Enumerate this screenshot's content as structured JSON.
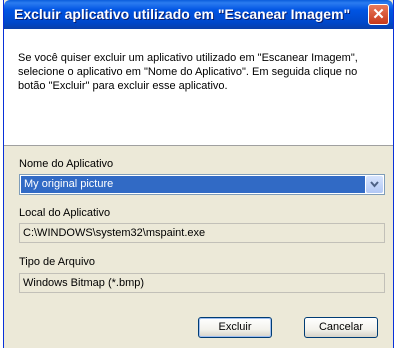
{
  "window": {
    "title": "Excluir aplicativo utilizado em \"Escanear Imagem\"",
    "close_glyph": "✕"
  },
  "description": "Se você quiser excluir um aplicativo utilizado em \"Escanear Imagem\", selecione o aplicativo em \"Nome do Aplicativo\". Em seguida clique no botão \"Excluir\" para excluir esse aplicativo.",
  "app_name": {
    "label": "Nome do Aplicativo",
    "selected": "My original picture"
  },
  "app_location": {
    "label": "Local do Aplicativo",
    "value": "C:\\WINDOWS\\system32\\mspaint.exe"
  },
  "file_type": {
    "label": "Tipo de Arquivo",
    "value": "Windows Bitmap (*.bmp)"
  },
  "buttons": {
    "delete": "Excluir",
    "cancel": "Cancelar"
  },
  "colors": {
    "titlebar": "#0054e3",
    "selection": "#316ac5",
    "dialog_bg": "#ece9d8"
  }
}
